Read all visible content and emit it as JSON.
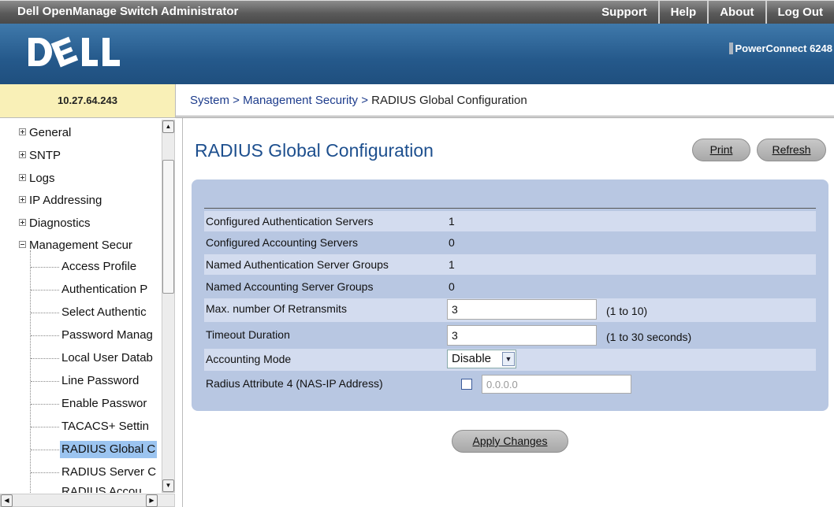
{
  "app_title": "Dell OpenManage Switch Administrator",
  "top_links": [
    "Support",
    "Help",
    "About",
    "Log Out"
  ],
  "brand": {
    "logo_text": "DELL",
    "product": "PowerConnect 6248"
  },
  "ip_address": "10.27.64.243",
  "breadcrumb": {
    "parts": [
      "System",
      "Management Security"
    ],
    "current": "RADIUS Global Configuration",
    "separator": " > "
  },
  "sidebar": {
    "nodes": [
      {
        "label": "General",
        "expander": "plus"
      },
      {
        "label": "SNTP",
        "expander": "plus"
      },
      {
        "label": "Logs",
        "expander": "plus"
      },
      {
        "label": "IP Addressing",
        "expander": "plus"
      },
      {
        "label": "Diagnostics",
        "expander": "plus"
      },
      {
        "label": "Management Secur",
        "expander": "minus"
      }
    ],
    "children": [
      {
        "label": "Access Profile"
      },
      {
        "label": "Authentication P"
      },
      {
        "label": "Select Authentic"
      },
      {
        "label": "Password Manag"
      },
      {
        "label": "Local User Datab"
      },
      {
        "label": "Line Password"
      },
      {
        "label": "Enable Passwor"
      },
      {
        "label": "TACACS+ Settin"
      },
      {
        "label": "RADIUS Global C",
        "selected": true
      },
      {
        "label": "RADIUS Server C"
      },
      {
        "label": "RADIUS Accou"
      }
    ]
  },
  "page": {
    "title": "RADIUS Global Configuration",
    "buttons": {
      "print": "Print",
      "refresh": "Refresh",
      "apply": "Apply Changes"
    },
    "fields": {
      "configured_auth_servers": {
        "label": "Configured Authentication Servers",
        "value": "1"
      },
      "configured_acct_servers": {
        "label": "Configured Accounting Servers",
        "value": "0"
      },
      "named_auth_groups": {
        "label": "Named Authentication Server Groups",
        "value": "1"
      },
      "named_acct_groups": {
        "label": "Named Accounting Server Groups",
        "value": "0"
      },
      "max_retransmits": {
        "label": "Max. number Of Retransmits",
        "value": "3",
        "hint": "(1 to 10)"
      },
      "timeout_duration": {
        "label": "Timeout Duration",
        "value": "3",
        "hint": "(1 to 30 seconds)"
      },
      "accounting_mode": {
        "label": "Accounting Mode",
        "value": "Disable"
      },
      "radius_attr4": {
        "label": "Radius Attribute 4 (NAS-IP Address)",
        "checked": false,
        "value": "0.0.0.0"
      }
    }
  },
  "colors": {
    "header_blue": "#25598b",
    "panel": "#b8c7e2",
    "title_blue": "#1d4f8e",
    "ip_box": "#f9f0b7"
  }
}
